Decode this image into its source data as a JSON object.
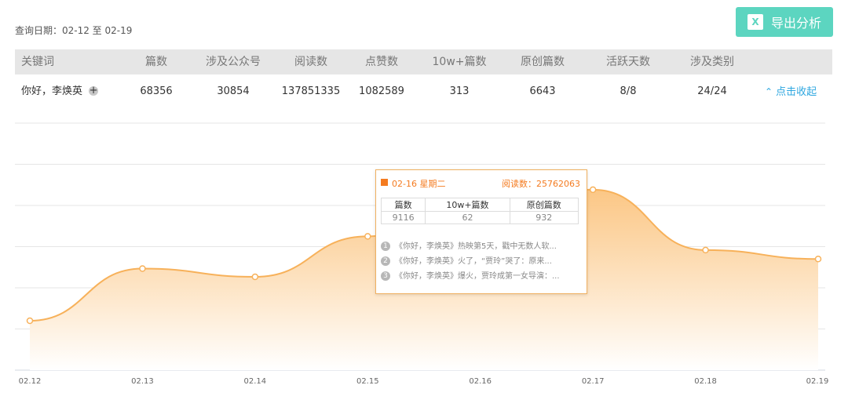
{
  "query_date": "查询日期：02-12 至 02-19",
  "export_button": {
    "icon": "excel-icon",
    "label": "导出分析"
  },
  "table": {
    "headers": [
      "关键词",
      "篇数",
      "涉及公众号",
      "阅读数",
      "点赞数",
      "10w+篇数",
      "原创篇数",
      "活跃天数",
      "涉及类别"
    ],
    "row": {
      "keyword": "你好，李焕英",
      "values": [
        "68356",
        "30854",
        "137851335",
        "1082589",
        "313",
        "6643",
        "8/8",
        "24/24"
      ]
    },
    "collapse_label": "点击收起"
  },
  "chart_data": {
    "type": "area",
    "x": [
      "02.12",
      "02.13",
      "02.14",
      "02.15",
      "02.16",
      "02.17",
      "02.18",
      "02.19"
    ],
    "series": [
      {
        "values": [
          7200000,
          14800000,
          13600000,
          19500000,
          25762063,
          26300000,
          17500000,
          16200000
        ]
      }
    ],
    "ylim": [
      0,
      36000000
    ],
    "grid": true,
    "colors": {
      "line": "#f7b15a",
      "fill_top": "#fbc47f",
      "fill_bottom": "#ffffff"
    }
  },
  "tooltip": {
    "date": "02-16  星期二",
    "read_label": "阅读数：25762063",
    "table_headers": [
      "篇数",
      "10w+篇数",
      "原创篇数"
    ],
    "table_values": [
      "9116",
      "62",
      "932"
    ],
    "articles": [
      "《你好，李焕英》热映第5天，戳中无数人软...",
      "《你好，李焕英》火了，“贾玲”哭了：原来...",
      "《你好，李焕英》爆火，贾玲成第一女导演：..."
    ]
  }
}
